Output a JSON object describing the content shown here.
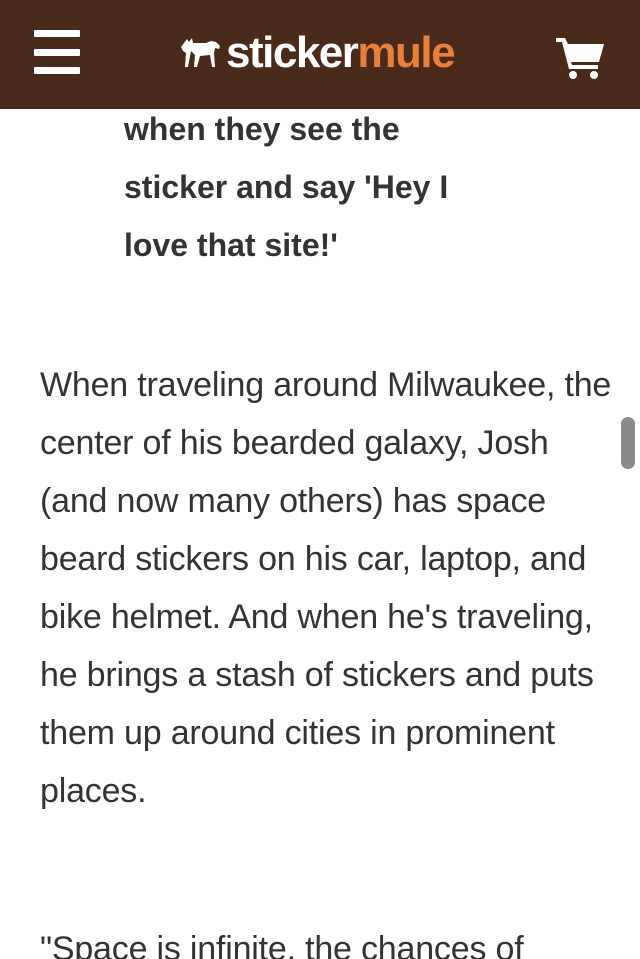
{
  "header": {
    "logo_sticker": "sticker",
    "logo_mule": "mule",
    "bg_color": "#4a2a1a",
    "accent_color": "#e8803c",
    "icons": [
      "menu-icon",
      "mule-logo-icon",
      "cart-icon"
    ]
  },
  "article": {
    "quote_line1": "when they see the",
    "quote_line2": "sticker and say 'Hey I",
    "quote_line3": "love that site!'",
    "paragraph": "When traveling around Milwaukee, the center of his bearded galaxy, Josh (and now many others) has space beard stickers on his car, laptop, and bike helmet. And when he's traveling, he brings a stash of stickers and puts them up around cities in prominent places.",
    "next_paragraph": "\"Space is infinite, the chances of"
  }
}
